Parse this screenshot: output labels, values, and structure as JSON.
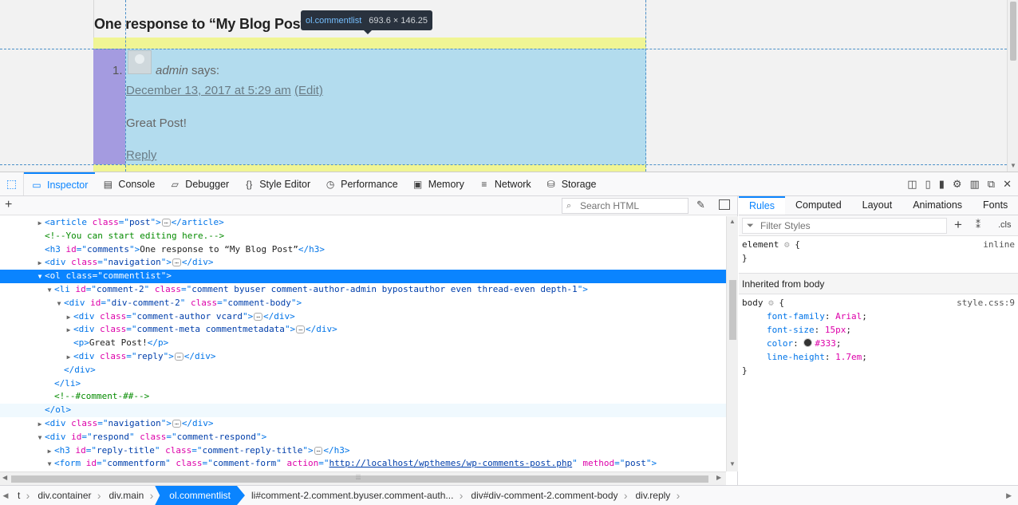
{
  "page": {
    "heading": "One response to “My Blog Post”",
    "comment_number": "1.",
    "author": "admin",
    "says": "says:",
    "date_link": "December 13, 2017 at 5:29 am",
    "edit_link": "(Edit)",
    "comment_text": "Great Post!",
    "reply_link": "Reply"
  },
  "tooltip": {
    "selector": "ol.commentlist",
    "dimensions": "693.6 × 146.25"
  },
  "toolbar": {
    "tabs": [
      {
        "label": "Inspector",
        "icon": "inspector-icon"
      },
      {
        "label": "Console",
        "icon": "console-icon"
      },
      {
        "label": "Debugger",
        "icon": "debugger-icon"
      },
      {
        "label": "Style Editor",
        "icon": "style-editor-icon"
      },
      {
        "label": "Performance",
        "icon": "performance-icon"
      },
      {
        "label": "Memory",
        "icon": "memory-icon"
      },
      {
        "label": "Network",
        "icon": "network-icon"
      },
      {
        "label": "Storage",
        "icon": "storage-icon"
      }
    ],
    "active_tab": "Inspector"
  },
  "markup": {
    "search_placeholder": "Search HTML",
    "rows": [
      {
        "tw": "▶",
        "parts": [
          [
            "tag",
            "<article "
          ],
          [
            "attr",
            "class"
          ],
          [
            "tag",
            "=\""
          ],
          [
            "val",
            "post"
          ],
          [
            "tag",
            "\">"
          ],
          [
            "ell",
            "⋯"
          ],
          [
            "tag",
            "</article>"
          ]
        ]
      },
      {
        "tw": "",
        "parts": [
          [
            "cmt",
            "<!--You can start editing here.-->"
          ]
        ]
      },
      {
        "tw": "",
        "parts": [
          [
            "tag",
            "<h3 "
          ],
          [
            "attr",
            "id"
          ],
          [
            "tag",
            "=\""
          ],
          [
            "val",
            "comments"
          ],
          [
            "tag",
            "\">"
          ],
          [
            "txt",
            "One response to “My Blog Post”"
          ],
          [
            "tag",
            "</h3>"
          ]
        ]
      },
      {
        "tw": "▶",
        "parts": [
          [
            "tag",
            "<div "
          ],
          [
            "attr",
            "class"
          ],
          [
            "tag",
            "=\""
          ],
          [
            "val",
            "navigation"
          ],
          [
            "tag",
            "\">"
          ],
          [
            "ell",
            "⋯"
          ],
          [
            "tag",
            "</div>"
          ]
        ]
      },
      {
        "tw": "▼",
        "parts": [
          [
            "tag",
            "<ol "
          ],
          [
            "attr",
            "class"
          ],
          [
            "tag",
            "=\""
          ],
          [
            "val",
            "commentlist"
          ],
          [
            "tag",
            "\">"
          ]
        ]
      },
      {
        "tw": "▼",
        "parts": [
          [
            "tag",
            "<li "
          ],
          [
            "attr",
            "id"
          ],
          [
            "tag",
            "=\""
          ],
          [
            "val",
            "comment-2"
          ],
          [
            "tag",
            "\" "
          ],
          [
            "attr",
            "class"
          ],
          [
            "tag",
            "=\""
          ],
          [
            "val",
            "comment byuser comment-author-admin bypostauthor even thread-even depth-1"
          ],
          [
            "tag",
            "\">"
          ]
        ]
      },
      {
        "tw": "▼",
        "parts": [
          [
            "tag",
            "<div "
          ],
          [
            "attr",
            "id"
          ],
          [
            "tag",
            "=\""
          ],
          [
            "val",
            "div-comment-2"
          ],
          [
            "tag",
            "\" "
          ],
          [
            "attr",
            "class"
          ],
          [
            "tag",
            "=\""
          ],
          [
            "val",
            "comment-body"
          ],
          [
            "tag",
            "\">"
          ]
        ]
      },
      {
        "tw": "▶",
        "parts": [
          [
            "tag",
            "<div "
          ],
          [
            "attr",
            "class"
          ],
          [
            "tag",
            "=\""
          ],
          [
            "val",
            "comment-author vcard"
          ],
          [
            "tag",
            "\">"
          ],
          [
            "ell",
            "⋯"
          ],
          [
            "tag",
            "</div>"
          ]
        ]
      },
      {
        "tw": "▶",
        "parts": [
          [
            "tag",
            "<div "
          ],
          [
            "attr",
            "class"
          ],
          [
            "tag",
            "=\""
          ],
          [
            "val",
            "comment-meta commentmetadata"
          ],
          [
            "tag",
            "\">"
          ],
          [
            "ell",
            "⋯"
          ],
          [
            "tag",
            "</div>"
          ]
        ]
      },
      {
        "tw": "",
        "parts": [
          [
            "tag",
            "<p>"
          ],
          [
            "txt",
            "Great Post!"
          ],
          [
            "tag",
            "</p>"
          ]
        ]
      },
      {
        "tw": "▶",
        "parts": [
          [
            "tag",
            "<div "
          ],
          [
            "attr",
            "class"
          ],
          [
            "tag",
            "=\""
          ],
          [
            "val",
            "reply"
          ],
          [
            "tag",
            "\">"
          ],
          [
            "ell",
            "⋯"
          ],
          [
            "tag",
            "</div>"
          ]
        ]
      },
      {
        "tw": "",
        "parts": [
          [
            "tag",
            "</div>"
          ]
        ]
      },
      {
        "tw": "",
        "parts": [
          [
            "tag",
            "</li>"
          ]
        ]
      },
      {
        "tw": "",
        "parts": [
          [
            "cmt",
            "<!--#comment-##-->"
          ]
        ]
      },
      {
        "tw": "",
        "parts": [
          [
            "tag",
            "</ol>"
          ]
        ]
      },
      {
        "tw": "▶",
        "parts": [
          [
            "tag",
            "<div "
          ],
          [
            "attr",
            "class"
          ],
          [
            "tag",
            "=\""
          ],
          [
            "val",
            "navigation"
          ],
          [
            "tag",
            "\">"
          ],
          [
            "ell",
            "⋯"
          ],
          [
            "tag",
            "</div>"
          ]
        ]
      },
      {
        "tw": "▼",
        "parts": [
          [
            "tag",
            "<div "
          ],
          [
            "attr",
            "id"
          ],
          [
            "tag",
            "=\""
          ],
          [
            "val",
            "respond"
          ],
          [
            "tag",
            "\" "
          ],
          [
            "attr",
            "class"
          ],
          [
            "tag",
            "=\""
          ],
          [
            "val",
            "comment-respond"
          ],
          [
            "tag",
            "\">"
          ]
        ]
      },
      {
        "tw": "▶",
        "parts": [
          [
            "tag",
            "<h3 "
          ],
          [
            "attr",
            "id"
          ],
          [
            "tag",
            "=\""
          ],
          [
            "val",
            "reply-title"
          ],
          [
            "tag",
            "\" "
          ],
          [
            "attr",
            "class"
          ],
          [
            "tag",
            "=\""
          ],
          [
            "val",
            "comment-reply-title"
          ],
          [
            "tag",
            "\">"
          ],
          [
            "ell",
            "⋯"
          ],
          [
            "tag",
            "</h3>"
          ]
        ]
      },
      {
        "tw": "▼",
        "parts": [
          [
            "tag",
            "<form "
          ],
          [
            "attr",
            "id"
          ],
          [
            "tag",
            "=\""
          ],
          [
            "val",
            "commentform"
          ],
          [
            "tag",
            "\" "
          ],
          [
            "attr",
            "class"
          ],
          [
            "tag",
            "=\""
          ],
          [
            "val",
            "comment-form"
          ],
          [
            "tag",
            "\" "
          ],
          [
            "attr",
            "action"
          ],
          [
            "tag",
            "=\""
          ],
          [
            "url",
            "http://localhost/wpthemes/wp-comments-post.php"
          ],
          [
            "tag",
            "\" "
          ],
          [
            "attr",
            "method"
          ],
          [
            "tag",
            "=\""
          ],
          [
            "val",
            "post"
          ],
          [
            "tag",
            "\">"
          ]
        ]
      }
    ]
  },
  "rules": {
    "tabs": [
      "Rules",
      "Computed",
      "Layout",
      "Animations",
      "Fonts"
    ],
    "active_tab": "Rules",
    "filter_placeholder": "Filter Styles",
    "cls_label": ".cls",
    "element_selector": "element",
    "element_open": "{",
    "element_close": "}",
    "element_source": "inline",
    "inherited_header": "Inherited from body",
    "body_selector": "body",
    "body_open": "{",
    "body_close": "}",
    "body_source": "style.css:9",
    "declarations": [
      {
        "prop": "font-family",
        "value": "Arial"
      },
      {
        "prop": "font-size",
        "value": "15px"
      },
      {
        "prop": "color",
        "value": "#333",
        "swatch": "#333333"
      },
      {
        "prop": "line-height",
        "value": "1.7em"
      }
    ]
  },
  "breadcrumbs": [
    {
      "label": "t"
    },
    {
      "label": "div.container"
    },
    {
      "label": "div.main"
    },
    {
      "label": "ol.commentlist",
      "selected": true
    },
    {
      "label": "li#comment-2.comment.byuser.comment-auth..."
    },
    {
      "label": "div#div-comment-2.comment-body"
    },
    {
      "label": "div.reply"
    }
  ],
  "colors": {
    "accent": "#0a84ff",
    "tag": "#0074e8",
    "attr": "#dd00a9",
    "value": "#003eaa",
    "comment": "#058b00"
  }
}
